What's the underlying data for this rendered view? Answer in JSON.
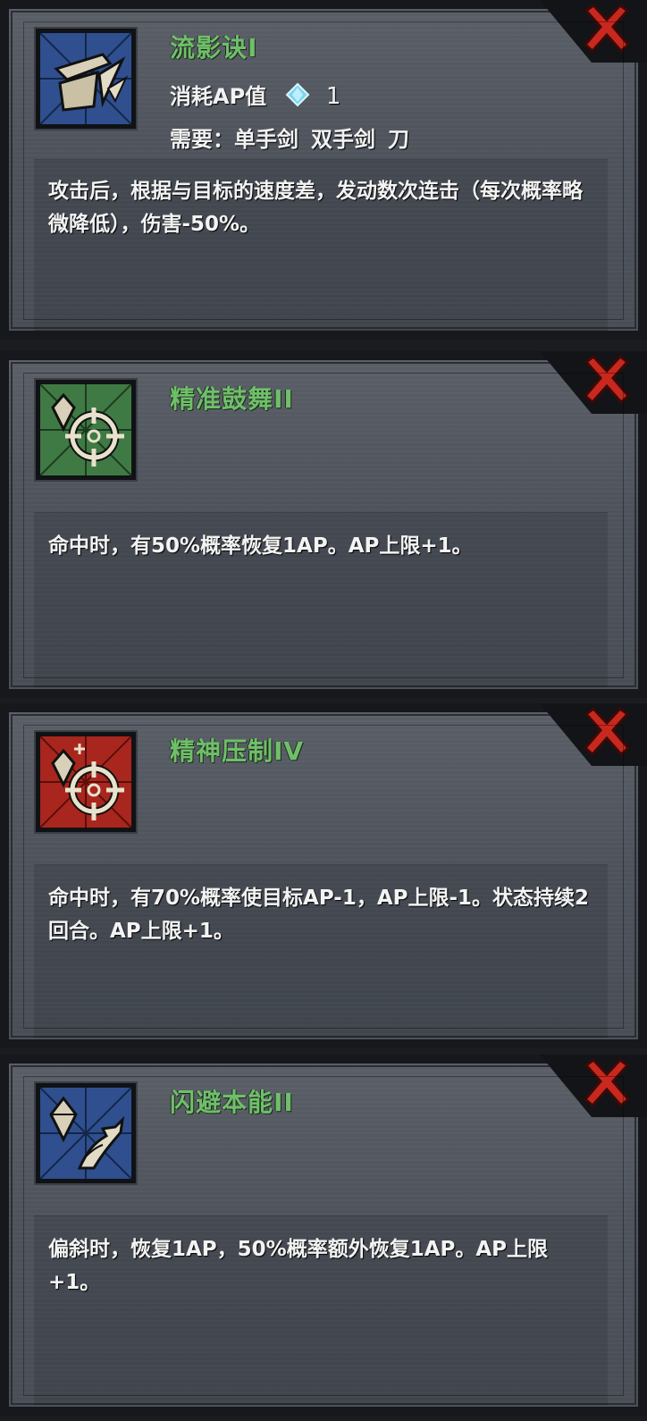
{
  "skills": [
    {
      "name": "流影诀I",
      "icon": "slash-strike-icon",
      "icon_bg": "#2f4f8f",
      "ap_cost_label": "消耗AP值",
      "ap_cost_value": "1",
      "requirement_label": "需要：",
      "requirements": [
        "单手剑",
        "双手剑",
        "刀"
      ],
      "description": "攻击后，根据与目标的速度差，发动数次连击（每次概率略微降低），伤害-50%。"
    },
    {
      "name": "精准鼓舞II",
      "icon": "crystal-crosshair-icon",
      "icon_bg": "#3f7a45",
      "description": "命中时，有50%概率恢复1AP。AP上限+1。"
    },
    {
      "name": "精神压制IV",
      "icon": "crystal-plus-crosshair-icon",
      "icon_bg": "#a8261e",
      "description": "命中时，有70%概率使目标AP-1，AP上限-1。状态持续2回合。AP上限+1。"
    },
    {
      "name": "闪避本能II",
      "icon": "crystal-bird-icon",
      "icon_bg": "#2f4f8f",
      "description": "偏斜时，恢复1AP，50%概率额外恢复1AP。AP上限+1。"
    }
  ],
  "colors": {
    "title": "#6fbf6a",
    "close": "#c8281e",
    "card_bg": "#53585f"
  }
}
